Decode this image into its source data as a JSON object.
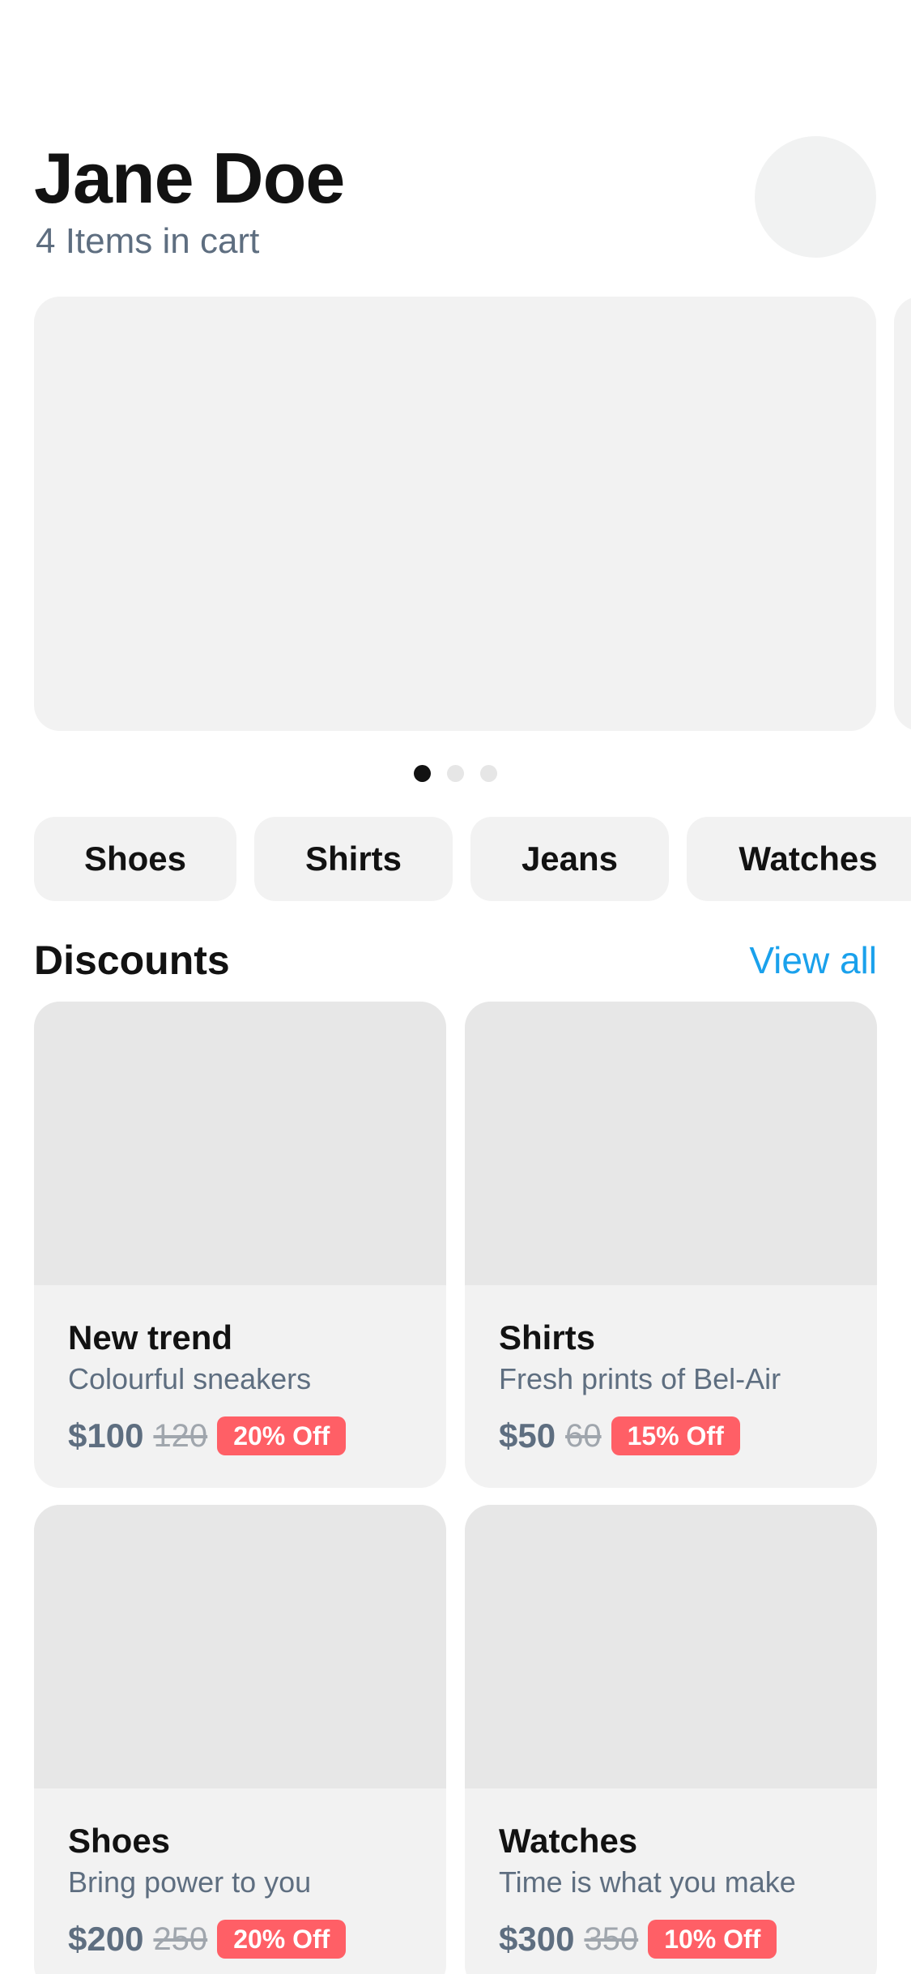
{
  "header": {
    "user_name": "Jane Doe",
    "cart_count": "4 Items in cart"
  },
  "carousel": {
    "slides": 3,
    "active_index": 0
  },
  "categories": [
    "Shoes",
    "Shirts",
    "Jeans",
    "Watches"
  ],
  "discounts": {
    "title": "Discounts",
    "view_all": "View all",
    "products": [
      {
        "title": "New trend",
        "subtitle": "Colourful sneakers",
        "price": "$100",
        "old_price": "120",
        "badge": "20% Off"
      },
      {
        "title": "Shirts",
        "subtitle": "Fresh prints of Bel-Air",
        "price": "$50",
        "old_price": "60",
        "badge": "15% Off"
      },
      {
        "title": "Shoes",
        "subtitle": "Bring power to you",
        "price": "$200",
        "old_price": "250",
        "badge": "20% Off"
      },
      {
        "title": "Watches",
        "subtitle": "Time is what you make",
        "price": "$300",
        "old_price": "350",
        "badge": "10% Off"
      }
    ]
  },
  "colors": {
    "accent": "#1aa1ec",
    "badge": "#ff5f66",
    "text_primary": "#121212",
    "text_secondary": "#5e6e80",
    "surface": "#f2f2f2"
  }
}
